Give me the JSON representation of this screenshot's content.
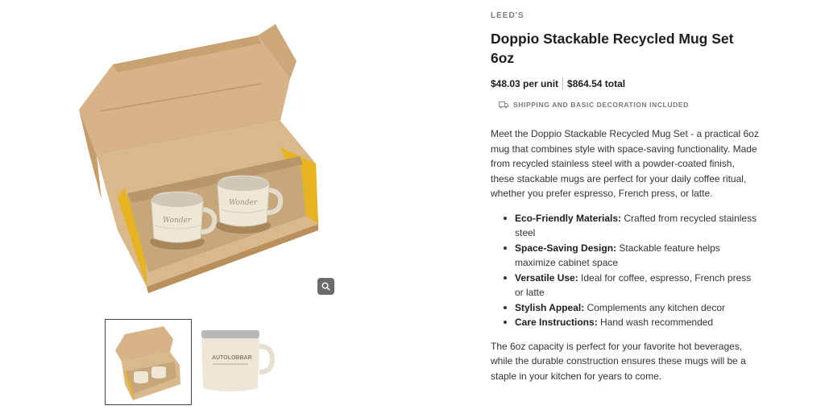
{
  "product": {
    "brand": "LEED'S",
    "title": "Doppio Stackable Recycled Mug Set 6oz",
    "price_per_unit": "$48.03 per unit",
    "price_total": "$864.54 total",
    "shipping_note": "SHIPPING AND BASIC DECORATION INCLUDED",
    "description": "Meet the Doppio Stackable Recycled Mug Set - a practical 6oz mug that combines style with space-saving functionality. Made from recycled stainless steel with a powder-coated finish, these stackable mugs are perfect for your daily coffee ritual, whether you prefer espresso, French press, or latte.",
    "features": [
      {
        "label": "Eco-Friendly Materials:",
        "text": " Crafted from recycled stainless steel"
      },
      {
        "label": "Space-Saving Design:",
        "text": " Stackable feature helps maximize cabinet space"
      },
      {
        "label": "Versatile Use:",
        "text": " Ideal for coffee, espresso, French press or latte"
      },
      {
        "label": "Stylish Appeal:",
        "text": " Complements any kitchen decor"
      },
      {
        "label": "Care Instructions:",
        "text": " Hand wash recommended"
      }
    ],
    "closing": "The 6oz capacity is perfect for your favorite hot beverages, while the durable construction ensures these mugs will be a staple in your kitchen for years to come."
  },
  "gallery": {
    "main_image_icon": "boxed-mug-set-image",
    "zoom_icon": "magnify-icon",
    "thumbnails": [
      {
        "icon": "boxed-mug-set-thumbnail",
        "selected": true
      },
      {
        "icon": "single-mug-thumbnail",
        "selected": false,
        "mug_text": "AUTOLOBBAR"
      }
    ]
  },
  "colors": {
    "cardboard": "#d9b98c",
    "cardboard_inner": "#cfae80",
    "yellow_side": "#e6b323",
    "mug_cream": "#eee7d8",
    "zoom_bg": "#6b6b6b"
  }
}
